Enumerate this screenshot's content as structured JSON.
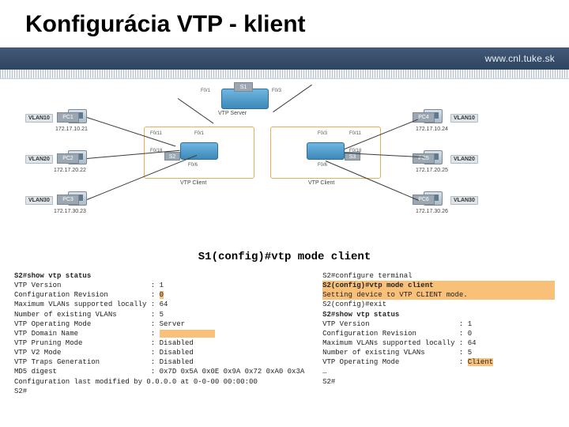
{
  "title": "Konfigurácia VTP - klient",
  "banner_url": "www.cnl.tuke.sk",
  "devices": {
    "s1": {
      "label": "S1",
      "role": "VTP Server"
    },
    "s2": {
      "label": "S2",
      "role": "VTP Client"
    },
    "s3": {
      "label": "S3",
      "role": "VTP Client"
    }
  },
  "ports": {
    "s1_f01": "F0/1",
    "s1_f03": "F0/3",
    "s2_f01": "F0/1",
    "s2_f011": "F0/11",
    "s2_f018": "F0/18",
    "s2_f06": "F0/6",
    "s3_f03": "F0/3",
    "s3_f011": "F0/11",
    "s3_f018": "F0/18",
    "s3_f06": "F0/6"
  },
  "pcs": {
    "pc1": {
      "name": "PC1",
      "vlan": "VLAN10",
      "ip": "172.17.10.21"
    },
    "pc2": {
      "name": "PC2",
      "vlan": "VLAN20",
      "ip": "172.17.20.22"
    },
    "pc3": {
      "name": "PC3",
      "vlan": "VLAN30",
      "ip": "172.17.30.23"
    },
    "pc4": {
      "name": "PC4",
      "vlan": "VLAN10",
      "ip": "172.17.10.24"
    },
    "pc5": {
      "name": "PC5",
      "vlan": "VLAN20",
      "ip": "172.17.20.25"
    },
    "pc6": {
      "name": "PC6",
      "vlan": "VLAN30",
      "ip": "172.17.30.26"
    }
  },
  "command": "S1(config)#vtp mode client",
  "cli_left": {
    "l0": "S2#show vtp status",
    "l1": "VTP Version                     : 1",
    "l2": "Configuration Revision          :",
    "l2v": "0",
    "l3": "Maximum VLANs supported locally : 64",
    "l4": "Number of existing VLANs        : 5",
    "l5": "VTP Operating Mode              : Server",
    "l6": "VTP Domain Name                 :",
    "l7": "VTP Pruning Mode                : Disabled",
    "l8": "VTP V2 Mode                     : Disabled",
    "l9": "VTP Traps Generation            : Disabled",
    "l10": "MD5 digest                      : 0x7D 0x5A 0x0E 0x9A 0x72 0xA0 0x3A",
    "l11": "Configuration last modified by 0.0.0.0 at 0-0-00 00:00:00",
    "l12": "S2#"
  },
  "cli_right": {
    "l0": "S2#configure terminal",
    "l1": "S2(config)#vtp mode client",
    "l2": "Setting device to VTP CLIENT mode.",
    "l3": "S2(config)#exit",
    "l4": "S2#show vtp status",
    "l5": "VTP Version                     : 1",
    "l6": "Configuration Revision          : 0",
    "l7": "Maximum VLANs supported locally : 64",
    "l8": "Number of existing VLANs        : 5",
    "l9": "VTP Operating Mode              :",
    "l9v": "Client",
    "l10": "…",
    "l11": "S2#"
  }
}
